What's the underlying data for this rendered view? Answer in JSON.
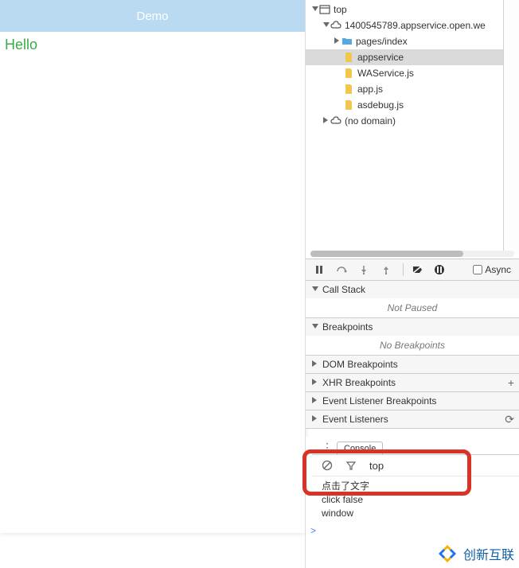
{
  "preview": {
    "title": "Demo",
    "body_text": "Hello"
  },
  "tree": {
    "top": "top",
    "domain": "1400545789.appservice.open.we",
    "folder": "pages/index",
    "files": [
      "appservice",
      "WAService.js",
      "app.js",
      "asdebug.js"
    ],
    "nodomain": "(no domain)"
  },
  "debugger": {
    "async": "Async",
    "callstack": {
      "title": "Call Stack",
      "body": "Not Paused"
    },
    "breakpoints": {
      "title": "Breakpoints",
      "body": "No Breakpoints"
    },
    "dom": "DOM Breakpoints",
    "xhr": "XHR Breakpoints",
    "evt": "Event Listener Breakpoints",
    "listeners": "Event Listeners"
  },
  "console": {
    "tab": "Console",
    "context": "top",
    "lines": [
      "点击了文字",
      "click false",
      "window"
    ],
    "prompt": ">"
  },
  "brand": "创新互联"
}
